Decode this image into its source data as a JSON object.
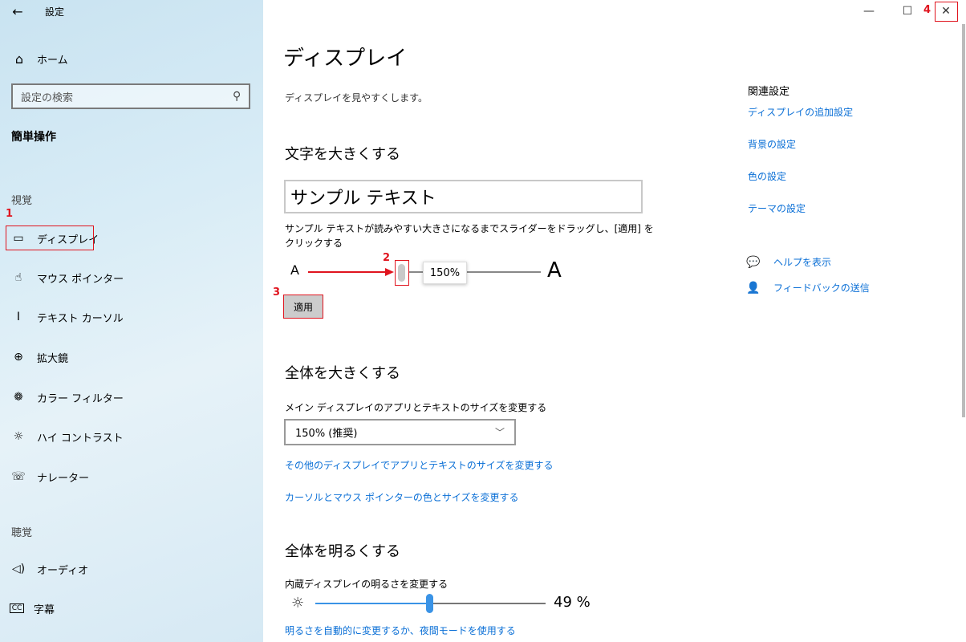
{
  "window": {
    "title": "設定",
    "close_icon": "close-icon"
  },
  "sidebar": {
    "home_label": "ホーム",
    "search_placeholder": "設定の検索",
    "category": "簡単操作",
    "groups": {
      "vision": "視覚",
      "hearing": "聴覚"
    },
    "items": [
      {
        "label": "ディスプレイ",
        "icon": "monitor-icon"
      },
      {
        "label": "マウス ポインター",
        "icon": "pointer-icon"
      },
      {
        "label": "テキスト カーソル",
        "icon": "text-cursor-icon"
      },
      {
        "label": "拡大鏡",
        "icon": "magnifier-icon"
      },
      {
        "label": "カラー フィルター",
        "icon": "palette-icon"
      },
      {
        "label": "ハイ コントラスト",
        "icon": "contrast-icon"
      },
      {
        "label": "ナレーター",
        "icon": "narrator-icon"
      },
      {
        "label": "オーディオ",
        "icon": "speaker-icon"
      },
      {
        "label": "字幕",
        "icon": "cc-icon"
      }
    ]
  },
  "annotations": {
    "n1": "1",
    "n2": "2",
    "n3": "3",
    "n4": "4",
    "color": "#e0141e"
  },
  "main": {
    "title": "ディスプレイ",
    "description": "ディスプレイを見やすくします。",
    "text_size": {
      "heading": "文字を大きくする",
      "sample": "サンプル テキスト",
      "instruction": "サンプル テキストが読みやすい大きさになるまでスライダーをドラッグし、[適用] をクリックする",
      "small_a": "A",
      "large_a": "A",
      "tooltip": "150%",
      "apply": "適用"
    },
    "scale": {
      "heading": "全体を大きくする",
      "label": "メイン ディスプレイのアプリとテキストのサイズを変更する",
      "selected": "150% (推奨)",
      "link1": "その他のディスプレイでアプリとテキストのサイズを変更する",
      "link2": "カーソルとマウス ポインターの色とサイズを変更する"
    },
    "brightness": {
      "heading": "全体を明るくする",
      "label": "内蔵ディスプレイの明るさを変更する",
      "value_text": "49 %",
      "value": 49,
      "link": "明るさを自動的に変更するか、夜間モードを使用する"
    }
  },
  "related": {
    "heading": "関連設定",
    "links": [
      "ディスプレイの追加設定",
      "背景の設定",
      "色の設定",
      "テーマの設定"
    ],
    "help": "ヘルプを表示",
    "feedback": "フィードバックの送信"
  },
  "colors": {
    "link": "#0a6fd6",
    "accent": "#3a93e6"
  }
}
